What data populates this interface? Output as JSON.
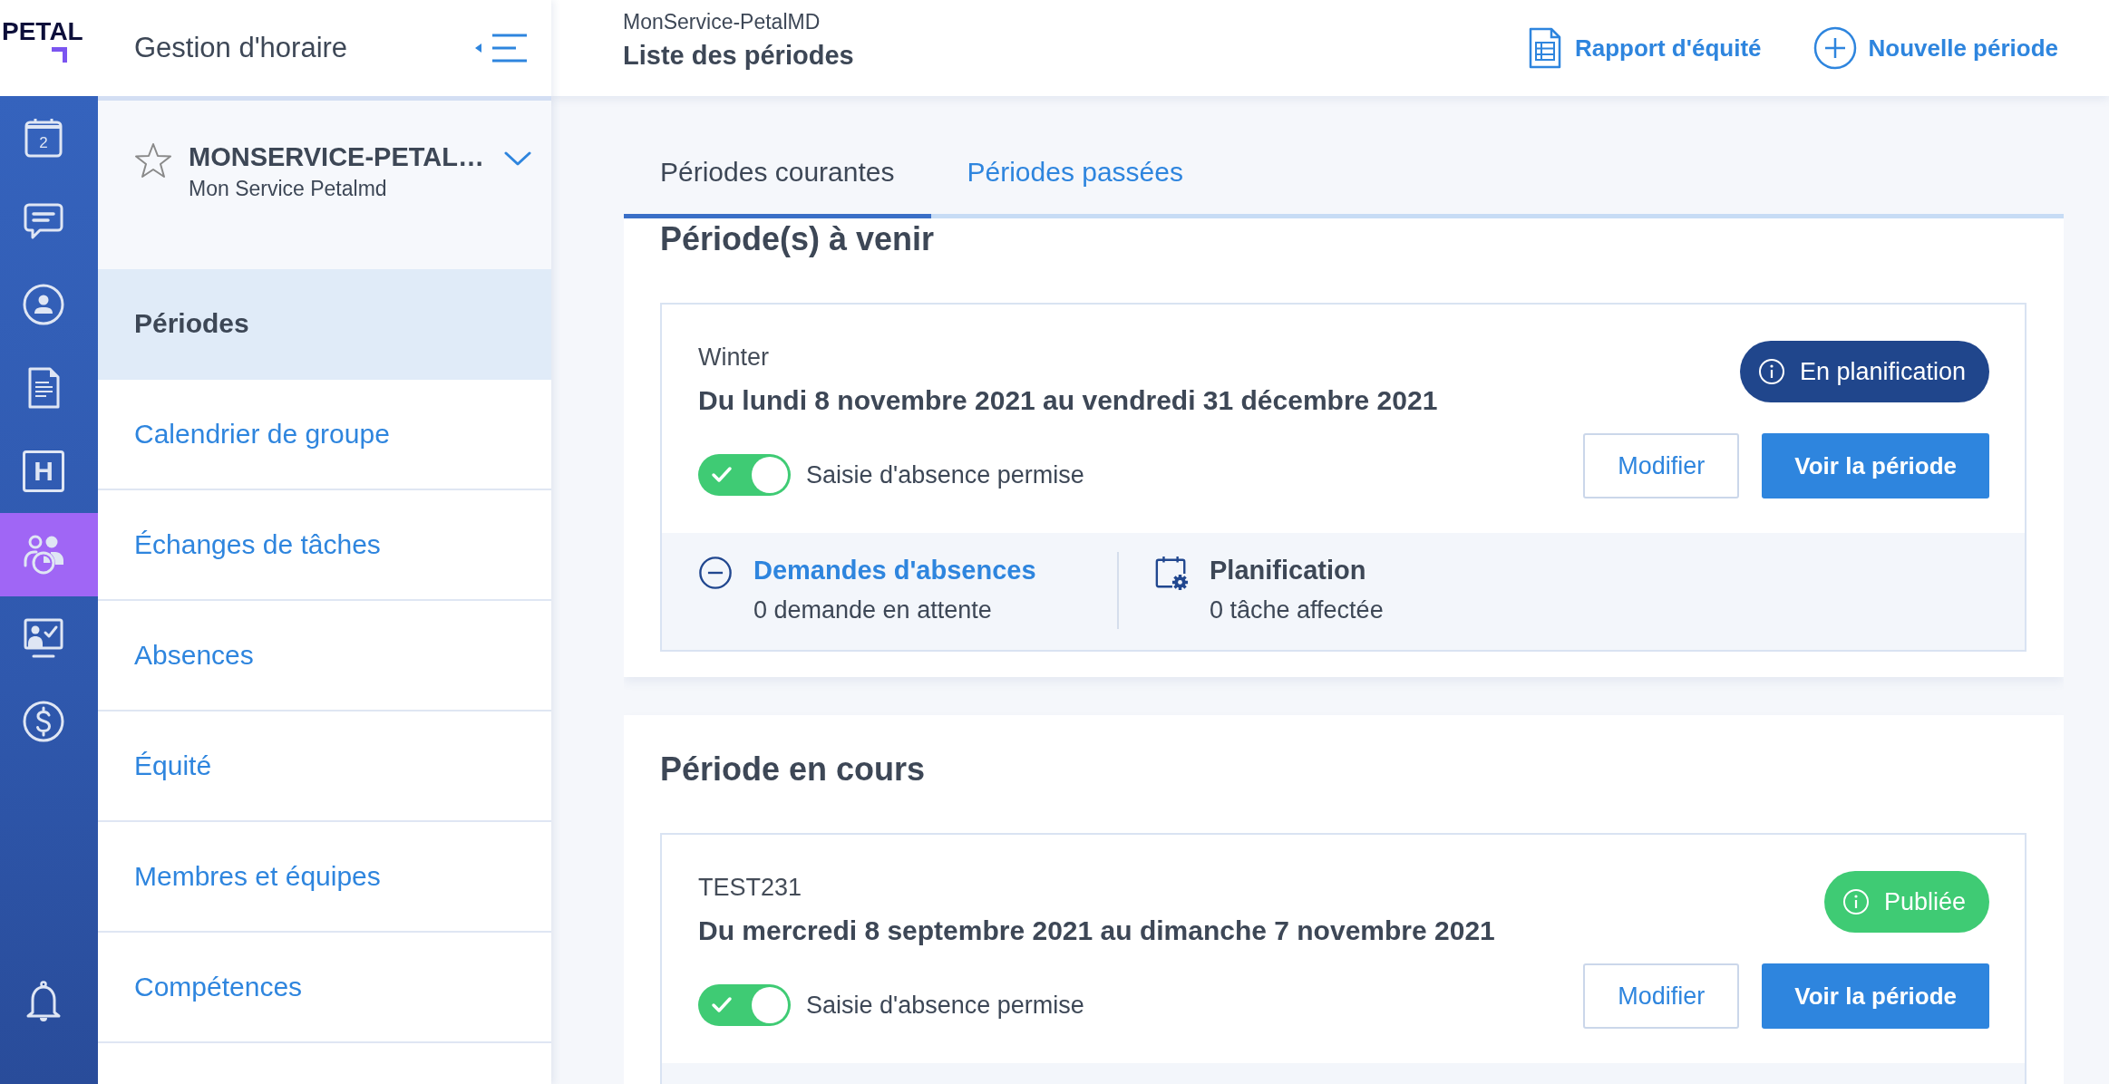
{
  "logo": {
    "text": "PETAL"
  },
  "rail": {
    "items": [
      {
        "kind": "calendar",
        "text": "2",
        "selected": false
      },
      {
        "kind": "chat",
        "selected": false
      },
      {
        "kind": "profile",
        "selected": false
      },
      {
        "kind": "document",
        "selected": false
      },
      {
        "kind": "letter",
        "text": "H",
        "selected": false
      },
      {
        "kind": "team",
        "selected": true
      },
      {
        "kind": "presentation",
        "selected": false
      },
      {
        "kind": "dollar",
        "selected": false
      }
    ],
    "bottom_items": [
      {
        "kind": "bell",
        "selected": false
      }
    ]
  },
  "sidebar": {
    "title": "Gestion d'horaire",
    "service": {
      "name": "MONSERVICE-PETAL…",
      "subtitle": "Mon Service Petalmd",
      "favorite": false
    },
    "items": [
      {
        "label": "Périodes",
        "selected": true
      },
      {
        "label": "Calendrier de groupe",
        "selected": false
      },
      {
        "label": "Échanges de tâches",
        "selected": false
      },
      {
        "label": "Absences",
        "selected": false
      },
      {
        "label": "Équité",
        "selected": false
      },
      {
        "label": "Membres et équipes",
        "selected": false
      },
      {
        "label": "Compétences",
        "selected": false
      }
    ]
  },
  "header": {
    "subtitle": "MonService-PetalMD",
    "title": "Liste des périodes",
    "actions": [
      {
        "kind": "report",
        "label": "Rapport d'équité"
      },
      {
        "kind": "add",
        "label": "Nouvelle période"
      }
    ]
  },
  "tabs": [
    {
      "label": "Périodes courantes",
      "selected": true
    },
    {
      "label": "Périodes passées",
      "selected": false
    }
  ],
  "sections": [
    {
      "title": "Période(s) à venir",
      "periods": [
        {
          "name": "Winter",
          "dates": "Du lundi 8 novembre 2021 au vendredi 31 décembre 2021",
          "status": {
            "label": "En planification",
            "color": "#20468c"
          },
          "absence_entry": {
            "on": true,
            "label": "Saisie d'absence permise"
          },
          "buttons": [
            {
              "kind": "secondary",
              "label": "Modifier"
            },
            {
              "kind": "primary",
              "label": "Voir la période"
            }
          ],
          "summary": [
            {
              "kind": "requests",
              "title": "Demandes d'absences",
              "detail": "0 demande en attente"
            },
            {
              "kind": "planning",
              "title": "Planification",
              "detail": "0 tâche affectée"
            }
          ]
        }
      ]
    },
    {
      "title": "Période en cours",
      "periods": [
        {
          "name": "TEST231",
          "dates": "Du mercredi 8 septembre 2021 au dimanche 7 novembre 2021",
          "status": {
            "label": "Publiée",
            "color": "#3fcb74"
          },
          "absence_entry": {
            "on": true,
            "label": "Saisie d'absence permise"
          },
          "buttons": [
            {
              "kind": "secondary",
              "label": "Modifier"
            },
            {
              "kind": "primary",
              "label": "Voir la période"
            }
          ]
        }
      ]
    }
  ]
}
